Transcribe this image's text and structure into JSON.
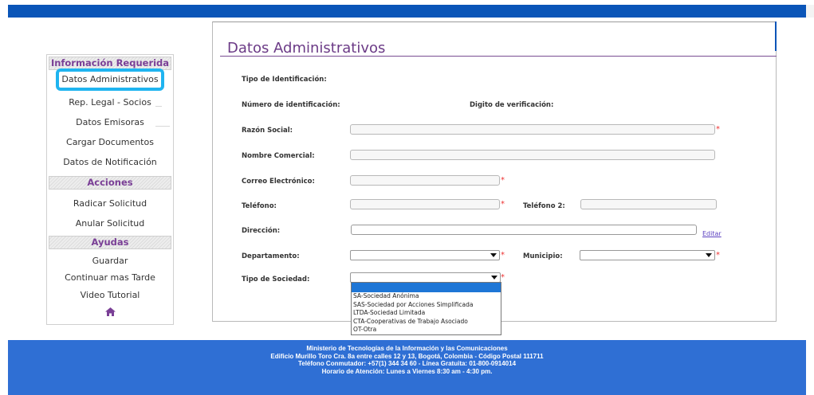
{
  "sidebar": {
    "sections": {
      "info_required": "Información Requerida",
      "actions": "Acciones",
      "helps": "Ayudas"
    },
    "items": {
      "datos_administrativos": "Datos Administrativos",
      "rep_legal": "Rep. Legal - Socios",
      "datos_emisoras": "Datos Emisoras",
      "cargar_documentos": "Cargar Documentos",
      "datos_notificacion": "Datos de Notificación",
      "radicar": "Radicar Solicitud",
      "anular": "Anular Solicitud",
      "guardar": "Guardar",
      "continuar": "Continuar mas Tarde",
      "video": "Video Tutorial"
    },
    "home_icon": "home-icon"
  },
  "form": {
    "title": "Datos Administrativos",
    "labels": {
      "tipo_identificacion": "Tipo de Identificación:",
      "numero_identificacion": "Número de identificación:",
      "digito_verificacion": "Digito de verificación:",
      "razon_social": "Razón Social:",
      "nombre_comercial": "Nombre Comercial:",
      "correo": "Correo Electrónico:",
      "telefono": "Teléfono:",
      "telefono2": "Teléfono 2:",
      "direccion": "Dirección:",
      "departamento": "Departamento:",
      "municipio": "Municipio:",
      "tipo_sociedad": "Tipo de Sociedad:"
    },
    "values": {
      "razon_social": "",
      "nombre_comercial": "",
      "correo": "",
      "telefono": "",
      "telefono2": "",
      "direccion": "",
      "departamento": "",
      "municipio": "",
      "tipo_sociedad": ""
    },
    "required_mark": "*",
    "edit_link": "Editar",
    "tipo_sociedad_options": [
      "SA-Sociedad Anónima",
      "SAS-Sociedad por Acciones Simplificada",
      "LTDA-Sociedad Limitada",
      "CTA-Cooperativas de Trabajo Asociado",
      "OT-Otra"
    ]
  },
  "footer": {
    "line1": "Ministerio de Tecnologías de la Información y las Comunicaciones",
    "line2": "Edificio Murillo Toro Cra. 8a entre calles 12 y 13, Bogotá, Colombia - Código Postal 111711",
    "line3": "Teléfono Conmutador: +57(1) 344 34 60 - Línea Gratuita: 01-800-0914014",
    "line4": "Horario de Atención: Lunes a Viernes 8:30 am - 4:30 pm."
  },
  "colors": {
    "top_bar": "#0a55b8",
    "footer": "#2f6fd4",
    "title_purple": "#6b3a86",
    "highlight": "#1fb4f0",
    "required": "#ee3333"
  }
}
